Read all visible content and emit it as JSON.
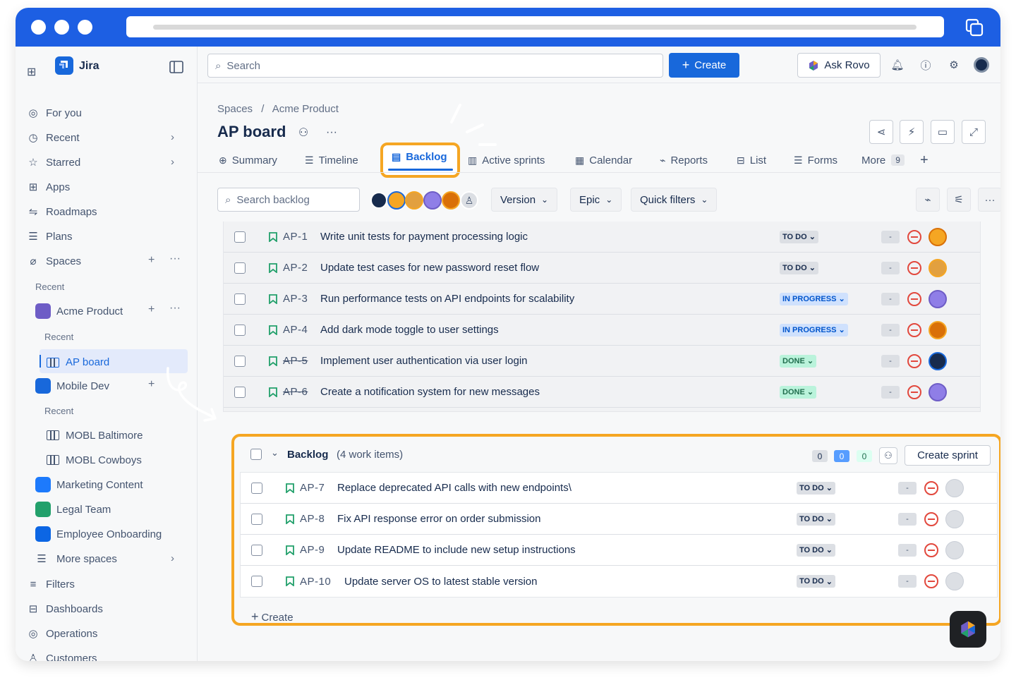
{
  "app": {
    "name": "Jira",
    "brand_color": "#1868db",
    "highlight_color": "#f5a623"
  },
  "topnav": {
    "search_placeholder": "Search",
    "create_label": "Create",
    "ask_rovo_label": "Ask Rovo",
    "icons": [
      "bell-icon",
      "help-icon",
      "settings-icon",
      "profile-avatar"
    ]
  },
  "sidebar": {
    "items": [
      {
        "label": "For you",
        "icon": "user-circle-icon"
      },
      {
        "label": "Recent",
        "icon": "clock-icon"
      },
      {
        "label": "Starred",
        "icon": "star-icon"
      },
      {
        "label": "Apps",
        "icon": "apps-icon"
      },
      {
        "label": "Roadmaps",
        "icon": "roadmap-icon"
      },
      {
        "label": "Plans",
        "icon": "plans-icon"
      },
      {
        "label": "Spaces",
        "icon": "spaces-icon"
      }
    ],
    "recent_label": "Recent",
    "spaces": [
      {
        "label": "Acme Product",
        "color": "#6e5dc6",
        "recent_label": "Recent",
        "boards": [
          "AP board"
        ]
      },
      {
        "label": "Mobile Dev",
        "color": "#1868db",
        "recent_label": "Recent",
        "boards": [
          "MOBL Baltimore",
          "MOBL Cowboys"
        ]
      },
      {
        "label": "Marketing Content",
        "color": "#1d7afc"
      },
      {
        "label": "Legal Team",
        "color": "#22a06b"
      },
      {
        "label": "Employee Onboarding",
        "color": "#0c66e4"
      }
    ],
    "more_spaces": "More spaces",
    "bottom": [
      {
        "label": "Filters",
        "icon": "filter-icon"
      },
      {
        "label": "Dashboards",
        "icon": "dashboard-icon"
      },
      {
        "label": "Operations",
        "icon": "operations-icon"
      },
      {
        "label": "Customers",
        "icon": "customers-icon"
      }
    ]
  },
  "page": {
    "breadcrumb": [
      "Spaces",
      "Acme Product"
    ],
    "title": "AP board",
    "tabs": [
      {
        "label": "Summary",
        "icon": "globe-icon"
      },
      {
        "label": "Timeline",
        "icon": "timeline-icon"
      },
      {
        "label": "Backlog",
        "icon": "backlog-icon",
        "active": true
      },
      {
        "label": "Active sprints",
        "icon": "board-icon"
      },
      {
        "label": "Calendar",
        "icon": "calendar-icon"
      },
      {
        "label": "Reports",
        "icon": "reports-icon"
      },
      {
        "label": "List",
        "icon": "list-icon"
      },
      {
        "label": "Forms",
        "icon": "forms-icon"
      },
      {
        "label": "More",
        "badge": "9"
      }
    ]
  },
  "toolbar": {
    "search_placeholder": "Search backlog",
    "filters": [
      "Version",
      "Epic",
      "Quick filters"
    ]
  },
  "sprint_items": [
    {
      "key": "AP-1",
      "summary": "Write unit tests for payment processing logic",
      "status": "TO DO",
      "done": false,
      "est": "-"
    },
    {
      "key": "AP-2",
      "summary": "Update test cases for new password reset flow",
      "status": "TO DO",
      "done": false,
      "est": "-"
    },
    {
      "key": "AP-3",
      "summary": "Run performance tests on API endpoints for scalability",
      "status": "IN PROGRESS",
      "done": false,
      "est": "-"
    },
    {
      "key": "AP-4",
      "summary": "Add dark mode toggle to user settings",
      "status": "IN PROGRESS",
      "done": false,
      "est": "-"
    },
    {
      "key": "AP-5",
      "summary": "Implement user authentication via user login",
      "status": "DONE",
      "done": true,
      "est": "-"
    },
    {
      "key": "AP-6",
      "summary": "Create a notification system for new messages",
      "status": "DONE",
      "done": true,
      "est": "-"
    }
  ],
  "backlog": {
    "title": "Backlog",
    "count_text": "(4 work items)",
    "counts": [
      "0",
      "0",
      "0"
    ],
    "create_sprint": "Create sprint",
    "create_label": "Create",
    "items": [
      {
        "key": "AP-7",
        "summary": "Replace deprecated API calls with new endpoints\\",
        "status": "TO DO",
        "est": "-"
      },
      {
        "key": "AP-8",
        "summary": "Fix API response error on order submission",
        "status": "TO DO",
        "est": "-"
      },
      {
        "key": "AP-9",
        "summary": "Update README to include new setup instructions",
        "status": "TO DO",
        "est": "-"
      },
      {
        "key": "AP-10",
        "summary": "Update server OS to latest stable version",
        "status": "TO DO",
        "est": "-"
      }
    ]
  }
}
